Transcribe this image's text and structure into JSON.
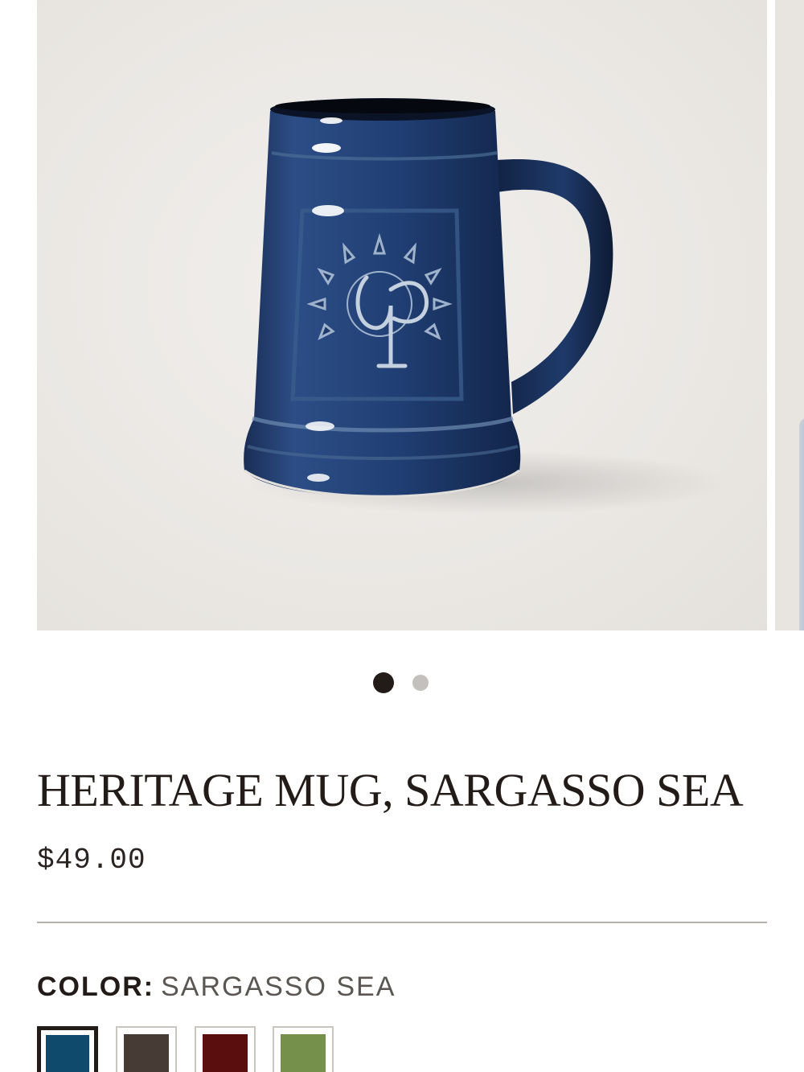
{
  "product": {
    "title": "HERITAGE MUG, SARGASSO SEA",
    "price": "$49.00"
  },
  "carousel": {
    "slide_count": 2,
    "active_index": 0
  },
  "color_selector": {
    "label": "COLOR:",
    "selected_name": "SARGASSO SEA",
    "swatches": [
      {
        "color": "#0f4a6c",
        "selected": true
      },
      {
        "color": "#473b36",
        "selected": false
      },
      {
        "color": "#5a0f0e",
        "selected": false
      },
      {
        "color": "#74904a",
        "selected": false
      }
    ]
  },
  "colors": {
    "mug_glaze": "#1f3b6a",
    "text_primary": "#231b18"
  }
}
